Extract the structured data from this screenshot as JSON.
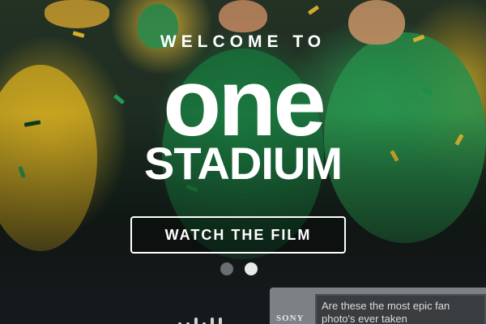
{
  "hero": {
    "welcome": "WELCOME TO",
    "logo_line1": "one",
    "logo_line2": "STADIUM",
    "cta_label": "WATCH THE FILM"
  },
  "carousel": {
    "slide_count": 2,
    "active_index": 1
  },
  "promo": {
    "brand": "SONY",
    "headline": "Are these the most epic fan photo's ever taken"
  },
  "colors": {
    "text": "#ffffff",
    "dot_inactive": "#6a6e70",
    "dot_active": "#e8eaea",
    "fan_green": "#1f8a48",
    "fan_yellow": "#d9b224"
  }
}
